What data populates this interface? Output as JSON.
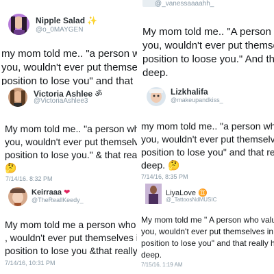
{
  "colors": {
    "text": "#14171a",
    "muted": "#8899a6",
    "divider": "#e6ecf0",
    "background": "#ffffff"
  },
  "panels": [
    {
      "name": "Nipple Salad",
      "name_emoji": "✨",
      "handle": "@o_0MAYGEN",
      "tweet_lines": [
        "my mom told me.. \"a person w",
        "you, wouldn't ever put themse",
        "position to lose you\" and that"
      ],
      "timestamp": ""
    },
    {
      "name": "",
      "handle": "@_vanessaaaahh_",
      "tweet_lines": [
        "My mom told me.. \"A person w",
        "you, wouldn't ever put themse",
        "position to loose you.\" And th",
        "deep."
      ],
      "timestamp": ""
    },
    {
      "name": "Victoria Ashlee",
      "name_emoji": "ॐ",
      "handle": "@VictoriaAshlee3",
      "tweet_lines": [
        "My mom told me.. \"a person wh",
        "you, wouldn't ever put themselv",
        "position to lose you.\" & that reall"
      ],
      "tweet_emoji": "🤔",
      "timestamp": "7/14/16, 8:32 PM"
    },
    {
      "name": "Lizkhalifa",
      "handle": "@makeupandkiss_",
      "tweet_lines": [
        "my mom told me.. \"a person wh",
        "you, wouldn't ever put themselve",
        "position to lose you\" and that rea",
        "deep."
      ],
      "tweet_emoji": "🤔",
      "timestamp": "7/14/16, 8:35 PM"
    },
    {
      "name": "Keirraaa",
      "name_emoji": "❤",
      "handle": "@TheReallKeedy_",
      "tweet_lines": [
        "My mom told me a person who v",
        ", wouldn't ever put themselves in",
        "position to lose you &that really h"
      ],
      "timestamp": "7/14/16, 10:31 PM"
    },
    {
      "name": "LiyaLove",
      "name_emoji": "♊",
      "handle": "@_TattoosNdMUSIC",
      "tweet_lines": [
        "My mom told me \" A person who valu",
        "you, wouldn't ever put themselves in",
        "position to lose you\" and that really h",
        "deep."
      ],
      "timestamp": "7/15/16, 1:19 AM"
    }
  ]
}
